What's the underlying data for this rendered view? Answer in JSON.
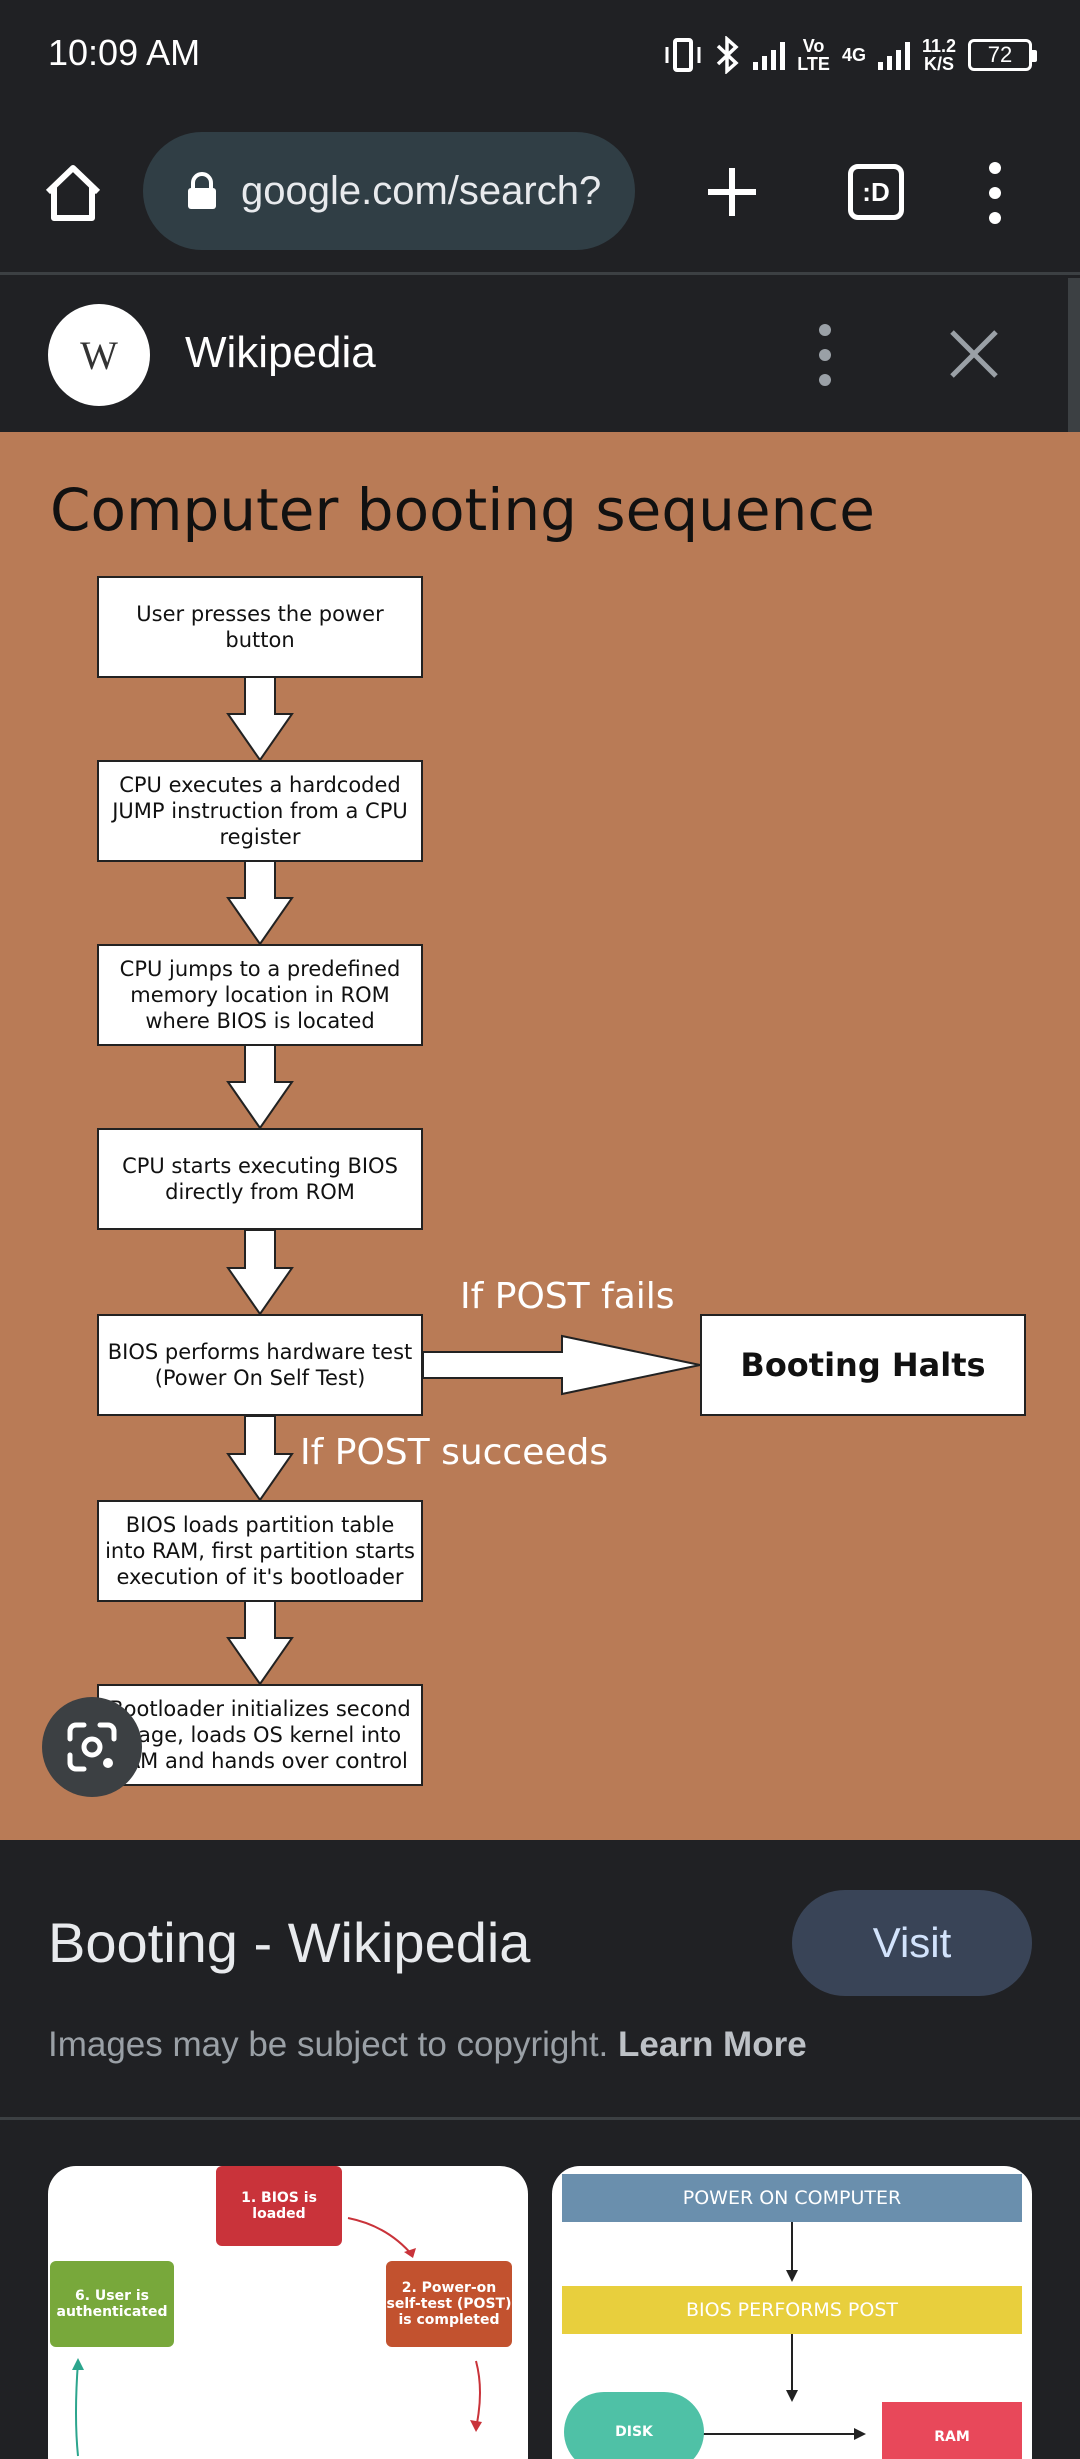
{
  "status_bar": {
    "time": "10:09 AM",
    "network_top": "Vo",
    "network_bottom": "LTE",
    "gen": "4G",
    "speed_top": "11.2",
    "speed_bottom": "K/S",
    "battery": "72"
  },
  "browser": {
    "url": "google.com/search?",
    "tab_label": ":D",
    "icons": [
      "home-icon",
      "lock-icon",
      "plus-icon",
      "tabs-icon",
      "more-vert-icon"
    ]
  },
  "source": {
    "logo_letter": "W",
    "name": "Wikipedia"
  },
  "image": {
    "title": "Computer booting sequence",
    "steps": [
      "User presses the power button",
      "CPU executes a hardcoded JUMP instruction from a CPU register",
      "CPU jumps to a predefined memory location in ROM where BIOS is located",
      "CPU starts executing BIOS directly from ROM",
      "BIOS performs hardware test (Power On Self Test)",
      "BIOS loads partition table into RAM, first partition starts execution of it's bootloader",
      "Bootloader initializes second stage, loads OS kernel into RAM and hands over control"
    ],
    "fail_label": "If POST fails",
    "success_label": "If POST succeeds",
    "halt_label": "Booting Halts",
    "background_color": "#b97b56"
  },
  "result": {
    "title": "Booting - Wikipedia",
    "visit_label": "Visit",
    "copyright_text": "Images may be subject to copyright.",
    "learn_more": "Learn More"
  },
  "related": {
    "thumb1": {
      "box1": "1. BIOS is loaded",
      "box2": "2. Power-on self-test (POST) is completed",
      "box6": "6. User is authenticated"
    },
    "thumb2": {
      "band1": "POWER ON COMPUTER",
      "band2": "BIOS PERFORMS POST",
      "disk": "DISK",
      "ram": "RAM"
    }
  }
}
